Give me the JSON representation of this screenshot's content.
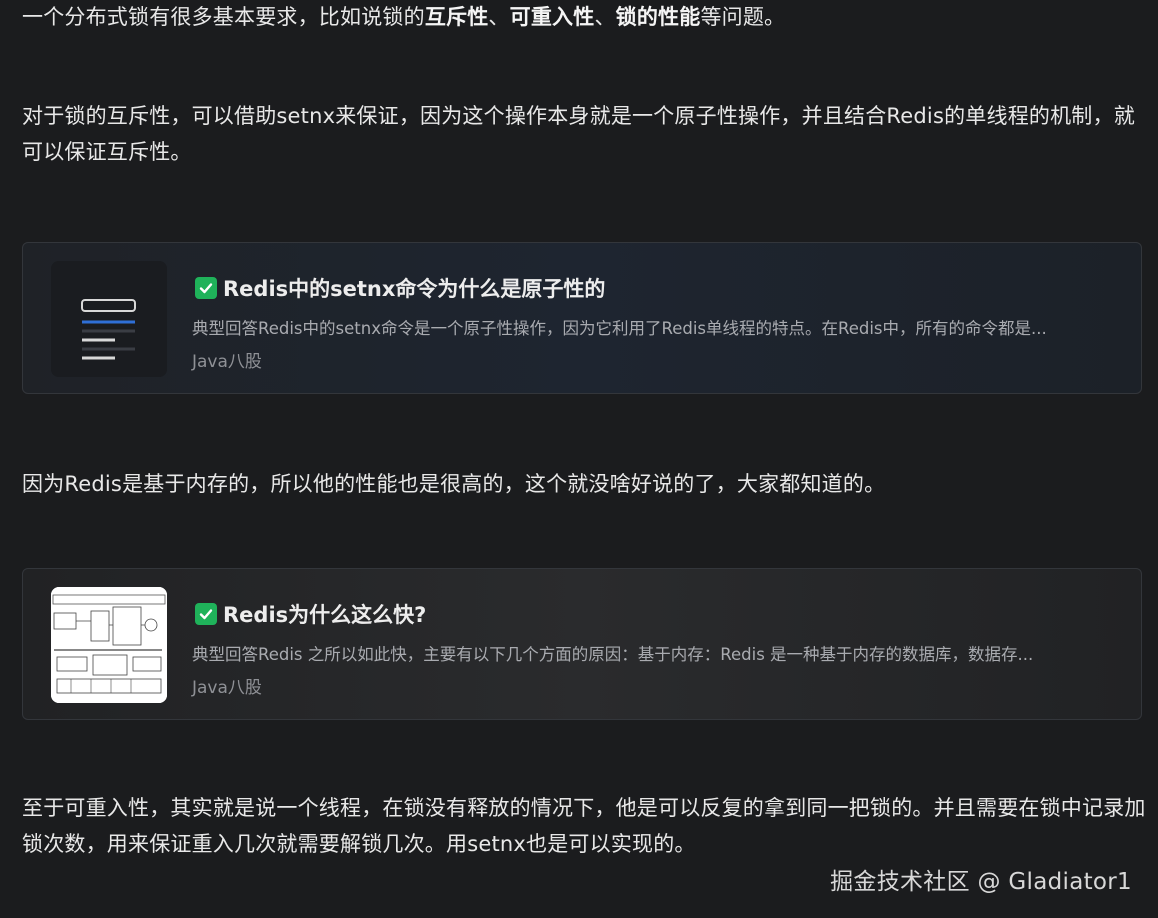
{
  "paragraphs": {
    "p1": {
      "pre": "一个分布式锁有很多基本要求，比如说锁的",
      "b1": "互斥性",
      "sep1": "、",
      "b2": "可重入性",
      "sep2": "、",
      "b3": "锁的性能",
      "post": "等问题。"
    },
    "p2": "对于锁的互斥性，可以借助setnx来保证，因为这个操作本身就是一个原子性操作，并且结合Redis的单线程的机制，就可以保证互斥性。",
    "p3": "因为Redis是基于内存的，所以他的性能也是很高的，这个就没啥好说的了，大家都知道的。",
    "p4": "至于可重入性，其实就是说一个线程，在锁没有释放的情况下，他是可以反复的拿到同一把锁的。并且需要在锁中记录加锁次数，用来保证重入几次就需要解锁几次。用setnx也是可以实现的。"
  },
  "cards": [
    {
      "title": "Redis中的setnx命令为什么是原子性的",
      "description": "典型回答Redis中的setnx命令是一个原子性操作，因为它利用了Redis单线程的特点。在Redis中，所有的命令都是...",
      "tag": "Java八股",
      "icon": "check-icon"
    },
    {
      "title": "Redis为什么这么快?",
      "description": "典型回答Redis 之所以如此快，主要有以下几个方面的原因：基于内存：Redis 是一种基于内存的数据库，数据存...",
      "tag": "Java八股",
      "icon": "check-icon"
    }
  ],
  "watermark": "掘金技术社区 @ Gladiator1",
  "colors": {
    "background": "#1b1c1e",
    "check_green": "#1fb25a",
    "thumb_accent_blue": "#2f6fd6"
  }
}
